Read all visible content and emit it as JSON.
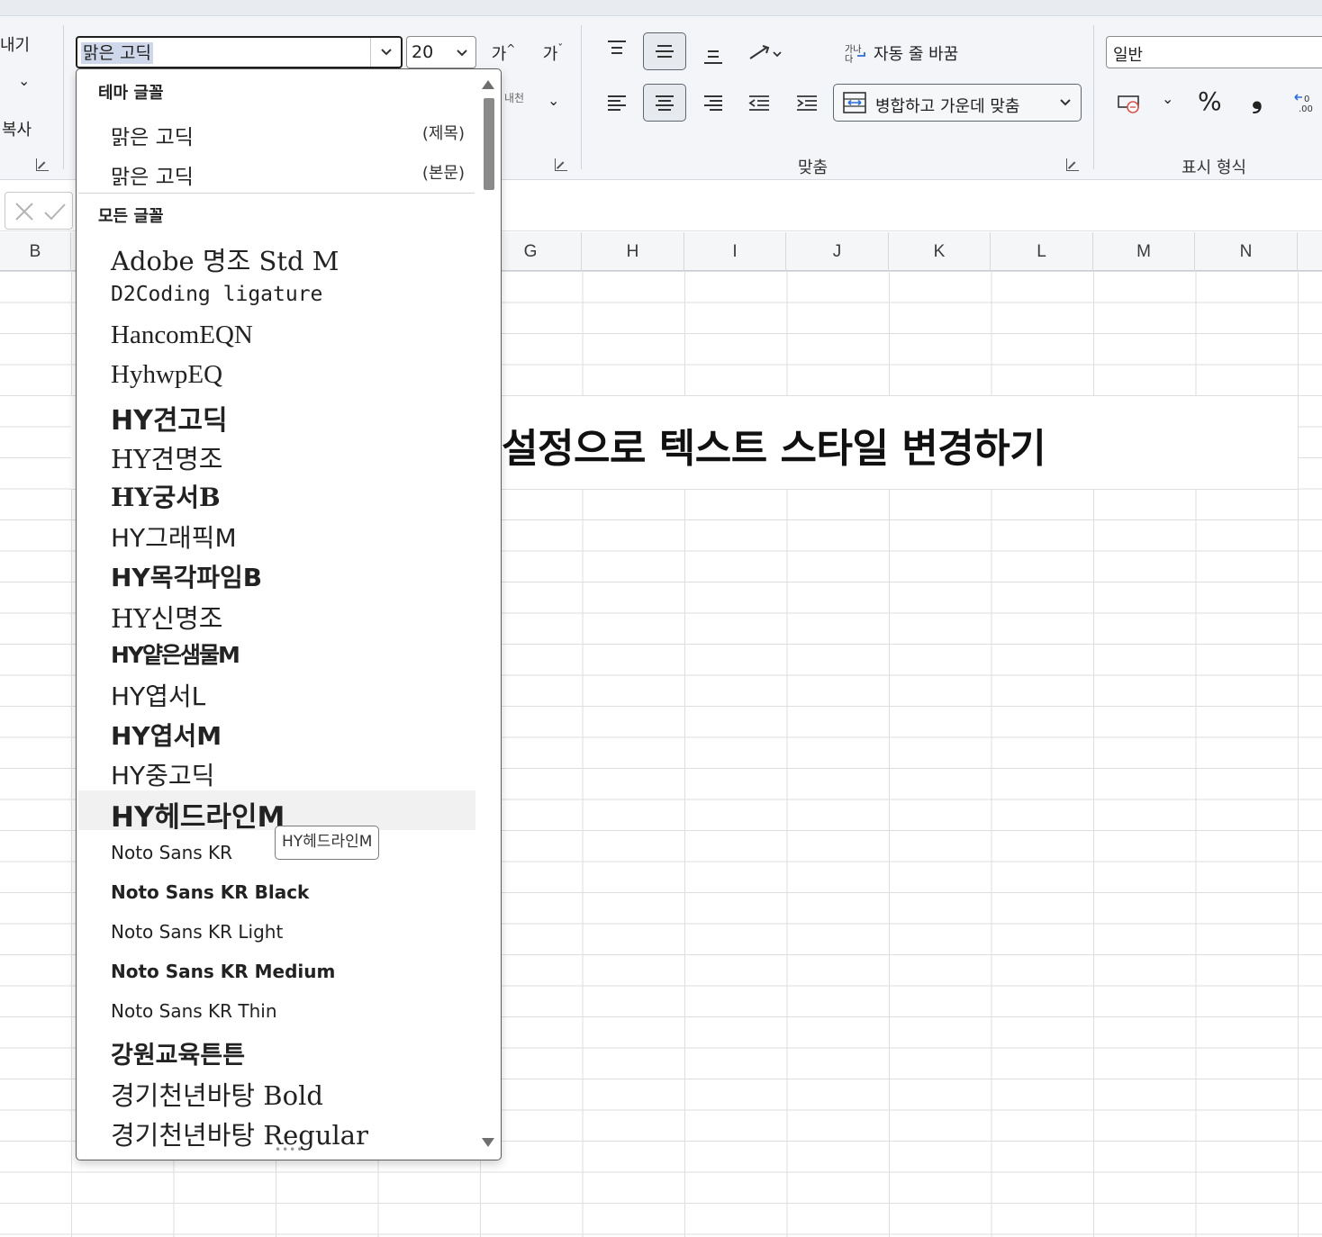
{
  "ribbon": {
    "clipboard": {
      "paste_partial": "내기",
      "copy_partial": "복사"
    },
    "font": {
      "font_name_value": "맑은 고딕",
      "font_size_value": "20",
      "increase_font_label": "가",
      "decrease_font_label": "가",
      "phonetic_label": "내천"
    },
    "alignment": {
      "wrap_text_label": "자동 줄 바꿈",
      "merge_center_label": "병합하고 가운데 맞춤",
      "group_label": "맞춤"
    },
    "number": {
      "format_value": "일반",
      "percent_label": "%",
      "comma_label": "❟",
      "group_label": "표시 형식"
    }
  },
  "columns": [
    "B",
    "G",
    "H",
    "I",
    "J",
    "K",
    "L",
    "M",
    "N"
  ],
  "sheet": {
    "merged_title_text": "설정으로 텍스트 스타일 변경하기"
  },
  "font_dropdown": {
    "theme_section_label": "테마 글꼴",
    "theme_fonts": [
      {
        "name": "맑은 고딕",
        "tag": "(제목)"
      },
      {
        "name": "맑은 고딕",
        "tag": "(본문)"
      }
    ],
    "all_section_label": "모든 글꼴",
    "all_fonts": [
      "Adobe 명조 Std M",
      "D2Coding ligature",
      "HancomEQN",
      "HyhwpEQ",
      "HY견고딕",
      "HY견명조",
      "HY궁서B",
      "HY그래픽M",
      "HY목각파임B",
      "HY신명조",
      "HY얕은샘물M",
      "HY엽서L",
      "HY엽서M",
      "HY중고딕",
      "HY헤드라인M",
      "Noto Sans KR",
      "Noto Sans KR Black",
      "Noto Sans KR Light",
      "Noto Sans KR Medium",
      "Noto Sans KR Thin",
      "강원교육튼튼",
      "경기천년바탕 Bold",
      "경기천년바탕 Regular"
    ],
    "hovered_font": "HY헤드라인M",
    "tooltip": "HY헤드라인M"
  },
  "colors": {
    "ribbon_bg": "#f3f5f8",
    "selection_highlight": "#cfd8ea",
    "hover_row": "#f1f1f1",
    "gridline": "#dedede"
  }
}
